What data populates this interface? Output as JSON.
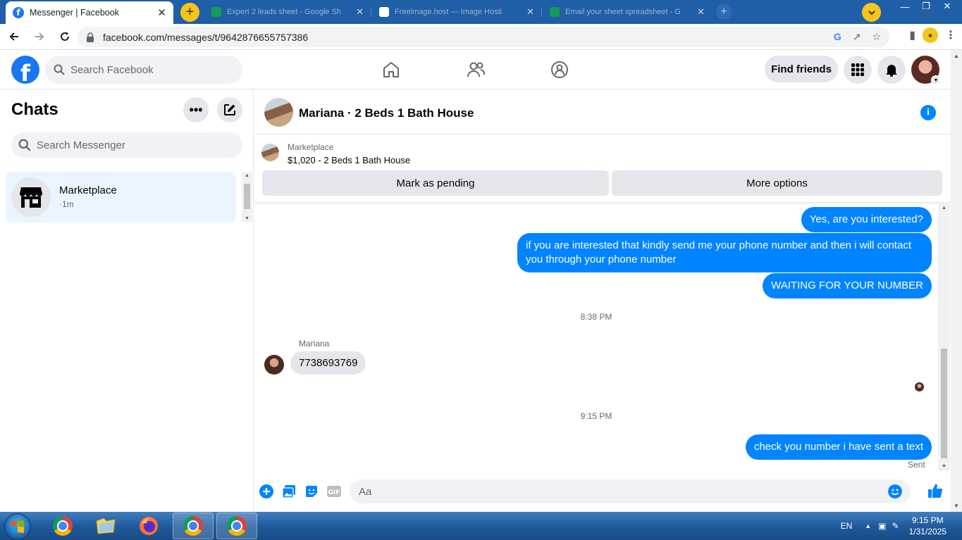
{
  "browser": {
    "active_tab_title": "Messenger | Facebook",
    "background_tabs": [
      {
        "title": "Expert 2 leads sheet - Google Sh",
        "favicon_color": "#0f9d58"
      },
      {
        "title": "Freeimage.host — Image Hosti",
        "favicon_color": "#ffffff"
      },
      {
        "title": "Email your sheet spreadsheet - G",
        "favicon_color": "#0f9d58"
      }
    ],
    "url": "facebook.com/messages/t/9642876655757386"
  },
  "fb": {
    "search_placeholder": "Search Facebook",
    "find_friends": "Find friends"
  },
  "chats": {
    "title": "Chats",
    "search_placeholder": "Search Messenger",
    "items": [
      {
        "name": "Marketplace",
        "time": "·1m"
      }
    ]
  },
  "conversation": {
    "title": "Mariana · 2 Beds 1 Bath House",
    "marketplace_label": "Marketplace",
    "listing": "$1,020 - 2 Beds 1 Bath House",
    "mark_pending": "Mark as pending",
    "more_options": "More options",
    "messages": [
      {
        "text": "Yes, are you interested?"
      },
      {
        "text": "if you are interested that kindly send me your phone number and then i will contact you through your phone number"
      },
      {
        "text": "WAITING FOR YOUR NUMBER"
      },
      {
        "timestamp": "8:38 PM"
      },
      {
        "sender": "Mariana",
        "text": "7738693769"
      },
      {
        "timestamp": "9:15 PM"
      },
      {
        "text": "check you number i have sent a text"
      }
    ],
    "sent_status": "Sent",
    "composer_placeholder": "Aa"
  },
  "taskbar": {
    "language": "EN",
    "time": "9:15 PM",
    "date": "1/31/2025"
  },
  "colors": {
    "messenger_blue": "#0084ff",
    "facebook_blue": "#1877f2",
    "selected_chat_bg": "#ebf5ff"
  }
}
